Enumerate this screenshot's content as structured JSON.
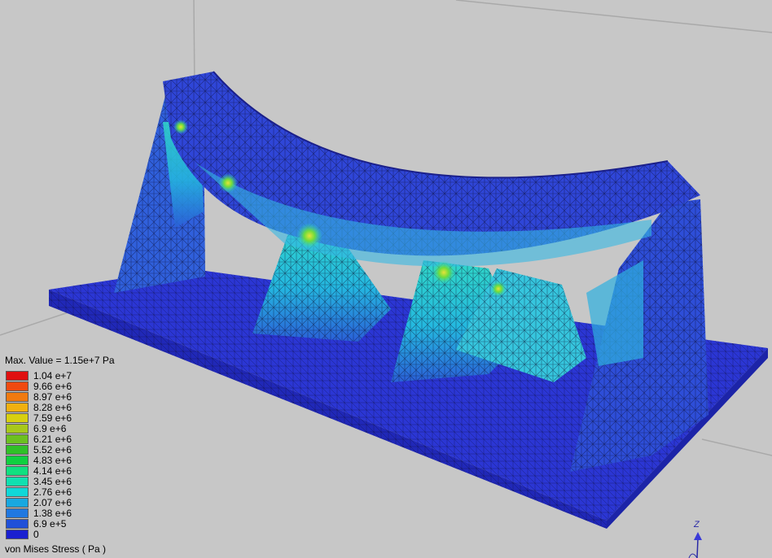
{
  "viewport": {
    "background_color": "#c7c7c7",
    "mesh_base_color": "#2b3bd6",
    "mesh_line_color": "#101030"
  },
  "legend": {
    "max_value": "Max. Value = 1.15e+7 Pa",
    "title": "von Mises  Stress  ( Pa )",
    "entries": [
      {
        "label": "1.04  e+7",
        "color": "#e01010"
      },
      {
        "label": "9.66  e+6",
        "color": "#f04a10"
      },
      {
        "label": "8.97  e+6",
        "color": "#f07a10"
      },
      {
        "label": "8.28  e+6",
        "color": "#f0b010"
      },
      {
        "label": "7.59  e+6",
        "color": "#d8d010"
      },
      {
        "label": "6.9    e+6",
        "color": "#a8c81a"
      },
      {
        "label": "6.21  e+6",
        "color": "#6cc020"
      },
      {
        "label": "5.52  e+6",
        "color": "#30c028"
      },
      {
        "label": "4.83  e+6",
        "color": "#10d040"
      },
      {
        "label": "4.14  e+6",
        "color": "#10e080"
      },
      {
        "label": "3.45  e+6",
        "color": "#10e0b0"
      },
      {
        "label": "2.76  e+6",
        "color": "#10d8d8"
      },
      {
        "label": "2.07  e+6",
        "color": "#18a8e0"
      },
      {
        "label": "1.38  e+6",
        "color": "#2078e0"
      },
      {
        "label": "6.9    e+5",
        "color": "#2050d8"
      },
      {
        "label": "0",
        "color": "#1a20d0"
      }
    ]
  },
  "axis": {
    "z_label": "Z",
    "color": "#2a2aa6"
  }
}
